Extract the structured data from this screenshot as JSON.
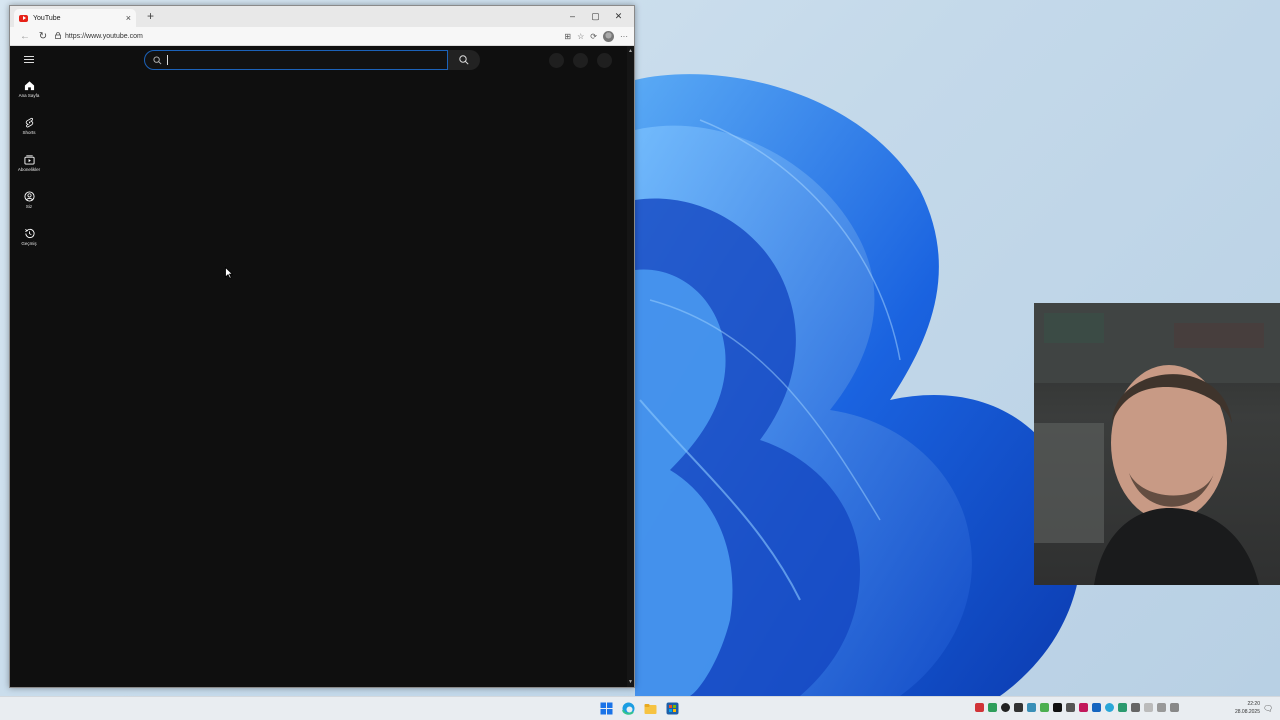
{
  "browser": {
    "tab_title": "YouTube",
    "tab_close": "×",
    "new_tab": "+",
    "window_controls": {
      "minimize": "–",
      "maximize": "▢",
      "close": "✕"
    },
    "url": "https://www.youtube.com",
    "more_menu": "···"
  },
  "youtube": {
    "search_placeholder": "",
    "sidebar": [
      {
        "label": "Ana Sayfa",
        "icon": "home-icon"
      },
      {
        "label": "Shorts",
        "icon": "shorts-icon"
      },
      {
        "label": "Abonelikler",
        "icon": "subscriptions-icon"
      },
      {
        "label": "Siz",
        "icon": "you-icon"
      },
      {
        "label": "Geçmiş",
        "icon": "history-icon"
      }
    ]
  },
  "taskbar": {
    "time": "22:20",
    "date": "28.08.2025"
  },
  "colors": {
    "youtube_bg": "#0f0f0f",
    "search_focus_border": "#1c62b9",
    "youtube_red": "#e62117",
    "wallpaper_blue": "#1e6fe0"
  }
}
